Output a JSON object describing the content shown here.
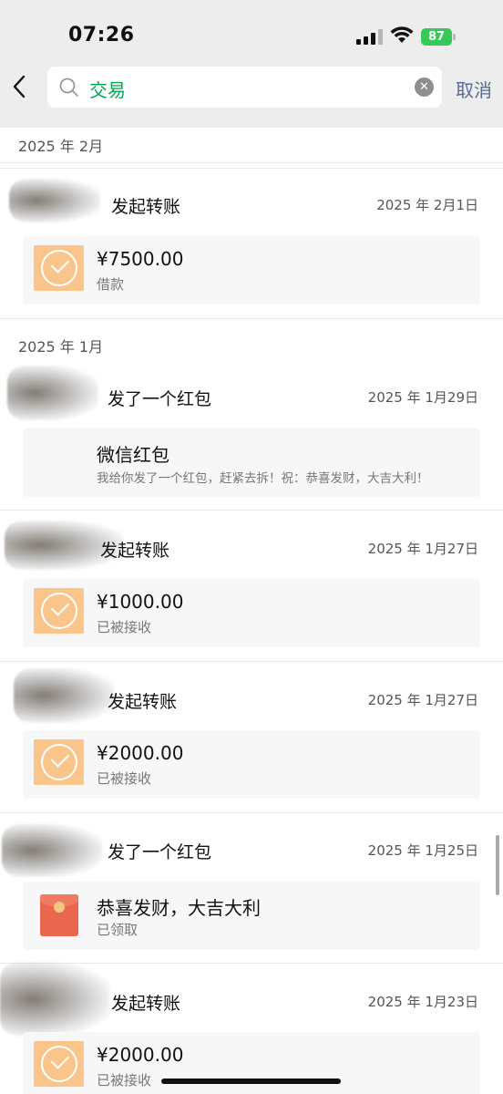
{
  "status_bar": {
    "time": "07:26",
    "battery": "87"
  },
  "search": {
    "query": "交易",
    "cancel_label": "取消"
  },
  "sections": [
    {
      "month": "2025 年 2月"
    },
    {
      "month": "2025 年 1月"
    }
  ],
  "entries": [
    {
      "title": "发起转账",
      "date": "2025 年 2月1日",
      "card_type": "transfer",
      "amount": "¥7500.00",
      "sub": "借款"
    },
    {
      "title": "发了一个红包",
      "date": "2025 年 1月29日",
      "card_type": "redpacket_text",
      "amount": "微信红包",
      "sub": "我给你发了一个红包，赶紧去拆！祝：恭喜发财，大吉大利！"
    },
    {
      "title": "发起转账",
      "date": "2025 年 1月27日",
      "card_type": "transfer",
      "amount": "¥1000.00",
      "sub": "已被接收"
    },
    {
      "title": "发起转账",
      "date": "2025 年 1月27日",
      "card_type": "transfer",
      "amount": "¥2000.00",
      "sub": "已被接收"
    },
    {
      "title": "发了一个红包",
      "date": "2025 年 1月25日",
      "card_type": "redpacket",
      "amount": "恭喜发财，大吉大利",
      "sub": "已领取"
    },
    {
      "title": "发起转账",
      "date": "2025 年 1月23日",
      "card_type": "transfer",
      "amount": "¥2000.00",
      "sub": "已被接收"
    }
  ],
  "icons": {
    "back": "chevron-left-icon",
    "search": "search-icon",
    "clear": "clear-icon",
    "transfer": "transfer-check-icon",
    "redpacket": "red-packet-icon"
  },
  "colors": {
    "accent_green": "#07a754",
    "link_blue": "#576b95",
    "transfer_orange": "#f9c58b",
    "redpacket_red": "#e9674e",
    "battery_green": "#38c759"
  }
}
